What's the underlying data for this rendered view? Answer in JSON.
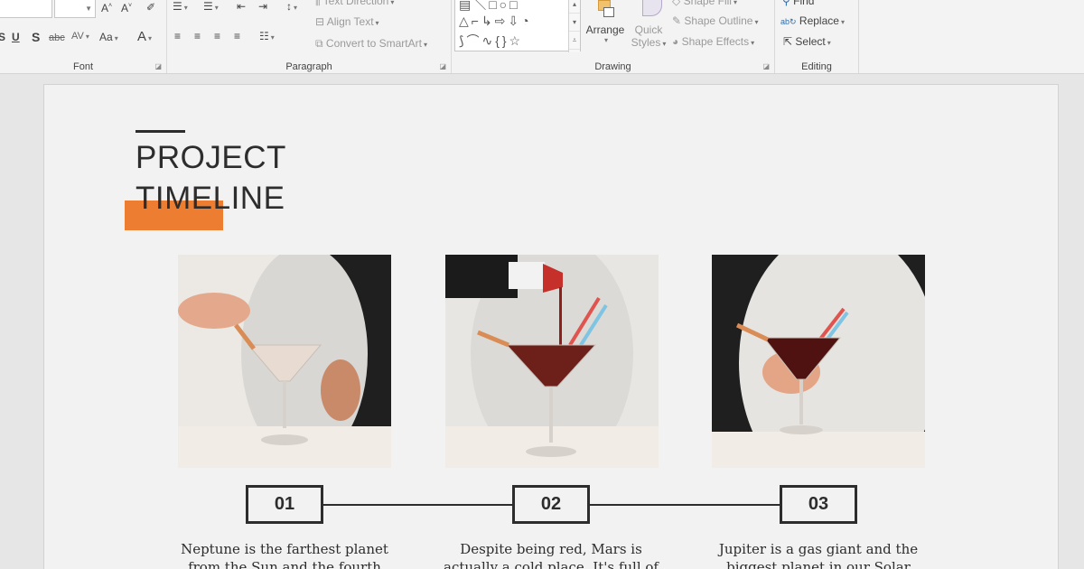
{
  "ribbon": {
    "font_group": {
      "label": "Font",
      "buttons": [
        "A˄",
        "A˅",
        "U",
        "S",
        "abc",
        "AV",
        "Aa",
        "A"
      ]
    },
    "paragraph_group": {
      "label": "Paragraph",
      "text_direction": "Text Direction",
      "align_text": "Align Text",
      "convert_smartart": "Convert to SmartArt"
    },
    "drawing_group": {
      "label": "Drawing",
      "arrange": "Arrange",
      "quick_styles_line1": "Quick",
      "quick_styles_line2": "Styles",
      "shape_fill": "Shape Fill",
      "shape_outline": "Shape Outline",
      "shape_effects": "Shape Effects"
    },
    "editing_group": {
      "label": "Editing",
      "find": "Find",
      "replace": "Replace",
      "select": "Select"
    }
  },
  "slide": {
    "title_line1": "PROJECT",
    "title_line2": "TIMELINE",
    "accent_color": "#ec7d31",
    "steps": [
      {
        "number": "01",
        "line1": "Neptune is the farthest planet",
        "line2": "from the Sun and the fourth"
      },
      {
        "number": "02",
        "line1": "Despite being red, Mars is",
        "line2": "actually a cold place. It's full of"
      },
      {
        "number": "03",
        "line1": "Jupiter is a gas giant and the",
        "line2": "biggest planet in our Solar"
      }
    ]
  }
}
